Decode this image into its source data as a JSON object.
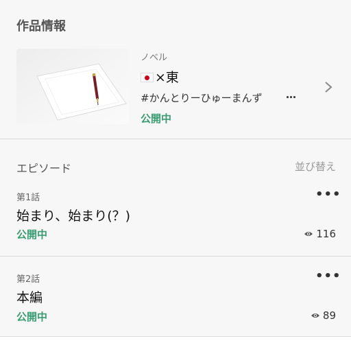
{
  "work_section": {
    "title": "作品情報"
  },
  "work": {
    "type": "ノベル",
    "title_suffix": "×東",
    "flag_icon": "japan-flag-icon",
    "tags": "#かんとりーひゅーまんず",
    "more": "…",
    "status": "公開中"
  },
  "episodes_section": {
    "title": "エピソード",
    "sort_label": "並び替え"
  },
  "episodes": [
    {
      "number": "第1話",
      "title": "始まり、始まり(？)",
      "status": "公開中",
      "views": "116"
    },
    {
      "number": "第2話",
      "title": "本編",
      "status": "公開中",
      "views": "89"
    }
  ],
  "colors": {
    "status_green": "#3a9d72",
    "flag_red": "#d0021b"
  }
}
